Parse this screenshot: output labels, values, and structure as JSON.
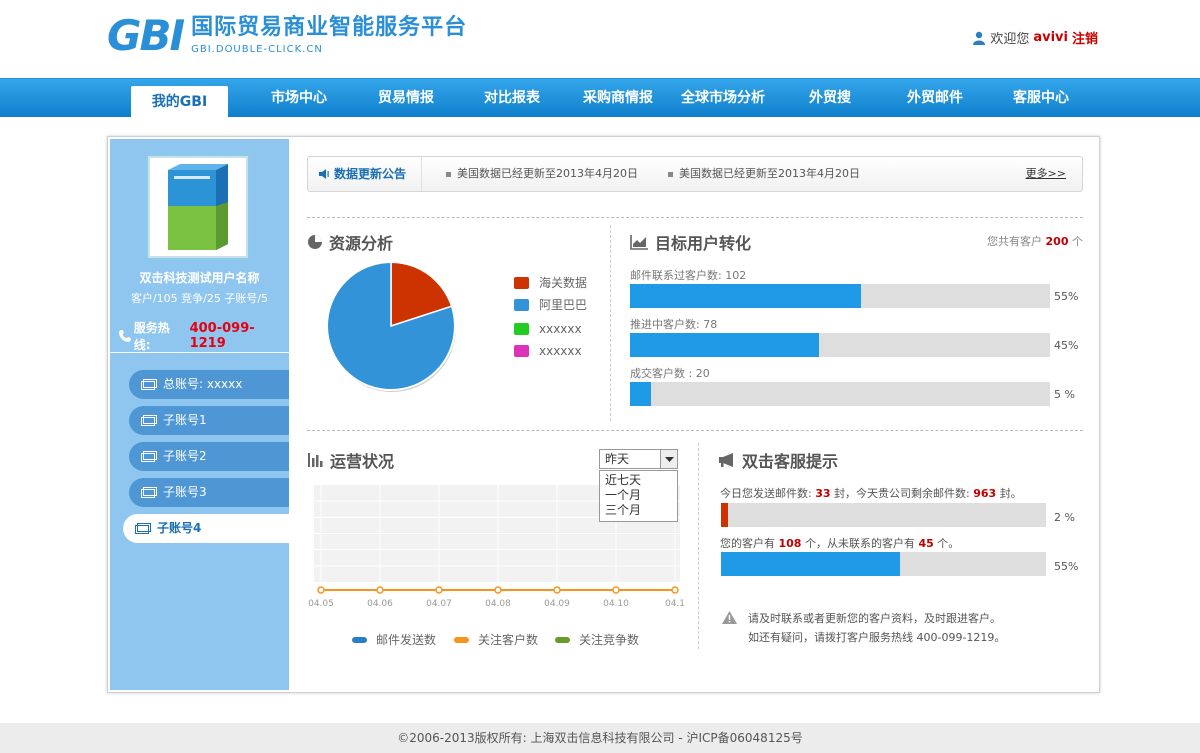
{
  "header": {
    "logo_mark": "GBI",
    "logo_cn": "国际贸易商业智能服务平台",
    "logo_en": "GBI.DOUBLE-CLICK.CN",
    "welcome": "欢迎您",
    "username": "avivi",
    "logout": "注销"
  },
  "nav": {
    "items": [
      "我的GBI",
      "市场中心",
      "贸易情报",
      "对比报表",
      "采购商情报",
      "全球市场分析",
      "外贸搜",
      "外贸邮件",
      "客服中心"
    ],
    "active_index": 0
  },
  "sidebar": {
    "user_name": "双击科技测试用户名称",
    "stats": "客户/105 竞争/25 子账号/5",
    "hotline_label": "服务热线:",
    "hotline_number": "400-099-1219",
    "accounts": [
      "总账号: xxxxx",
      "子账号1",
      "子账号2",
      "子账号3",
      "子账号4"
    ],
    "active_account": 4
  },
  "notice": {
    "title": "数据更新公告",
    "items": [
      "美国数据已经更新至2013年4月20日",
      "美国数据已经更新至2013年4月20日"
    ],
    "more": "更多>>"
  },
  "resource": {
    "title": "资源分析",
    "chart_data": {
      "type": "pie",
      "slices": [
        {
          "name": "海关数据",
          "value": 20,
          "color": "#cc3300"
        },
        {
          "name": "阿里巴巴",
          "value": 80,
          "color": "#3393d8"
        },
        {
          "name": "xxxxxx",
          "value": 0,
          "color": "#22cc22"
        },
        {
          "name": "xxxxxx",
          "value": 0,
          "color": "#dd33bb"
        }
      ]
    }
  },
  "target": {
    "title": "目标用户转化",
    "total_prefix": "您共有客户",
    "total_value": "200",
    "total_suffix": "个",
    "bars": [
      {
        "label": "邮件联系过客户数: 102",
        "value": 55,
        "pct_text": "55%"
      },
      {
        "label": "推进中客户数: 78",
        "value": 45,
        "pct_text": "45%"
      },
      {
        "label": "成交客户数 : 20",
        "value": 5,
        "pct_text": "5 %"
      }
    ],
    "bar_color": "#1e9ae6"
  },
  "operation": {
    "title": "运营状况",
    "select_value": "昨天",
    "select_options": [
      "近七天",
      "一个月",
      "三个月"
    ],
    "chart_data": {
      "type": "line",
      "x": [
        "04.05",
        "04.06",
        "04.07",
        "04.08",
        "04.09",
        "04.10",
        "04.1"
      ],
      "series": [
        {
          "name": "邮件发送数",
          "values": [
            0,
            0,
            0,
            0,
            0,
            0,
            0
          ],
          "color": "#2a7ec4"
        },
        {
          "name": "关注客户数",
          "values": [
            0,
            0,
            0,
            0,
            0,
            0,
            0
          ],
          "color": "#f7941d"
        },
        {
          "name": "关注竞争数",
          "values": [
            0,
            0,
            0,
            0,
            0,
            0,
            0
          ],
          "color": "#6a9a2e"
        }
      ]
    }
  },
  "service": {
    "title": "双击客服提示",
    "line1_a": "今日您发送邮件数:",
    "line1_n1": "33",
    "line1_b": "封，今天贵公司剩余邮件数:",
    "line1_n2": "963",
    "line1_c": "封。",
    "bar1": {
      "value": 2,
      "pct_text": "2 %",
      "color": "#cc3300"
    },
    "line2_a": "您的客户有",
    "line2_n1": "108",
    "line2_b": "个，从未联系的客户有",
    "line2_n2": "45",
    "line2_c": "个。",
    "bar2": {
      "value": 55,
      "pct_text": "55%",
      "color": "#1e9ae6"
    },
    "tip1": "请及时联系或者更新您的客户资料，及时跟进客户。",
    "tip2": "如还有疑问，请拨打客户服务热线 400-099-1219。"
  },
  "footer": {
    "text": "©2006-2013版权所有: 上海双击信息科技有限公司 - 沪ICP备06048125号"
  }
}
